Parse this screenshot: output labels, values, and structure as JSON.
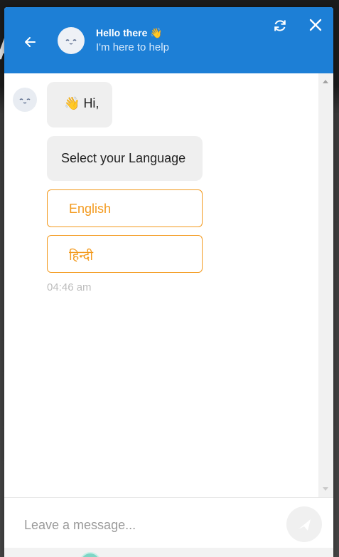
{
  "backdrop": {
    "letter": "A"
  },
  "header": {
    "title": "Hello there",
    "title_emoji": "👋",
    "subtitle": "I'm here to help",
    "back_icon": "arrow-left-icon",
    "refresh_icon": "refresh-icon",
    "close_icon": "close-icon",
    "color": "#1d7fd6"
  },
  "messages": [
    {
      "emoji": "👋",
      "text": "Hi,"
    },
    {
      "text": "Select your Language"
    }
  ],
  "options": [
    {
      "label": "English"
    },
    {
      "label": "हिन्दी"
    }
  ],
  "timestamp": "04:46 am",
  "composer": {
    "placeholder": "Leave a message...",
    "send_icon": "send-icon"
  },
  "colors": {
    "accent_orange": "#f39a1e",
    "bubble_bg": "#efefef"
  }
}
